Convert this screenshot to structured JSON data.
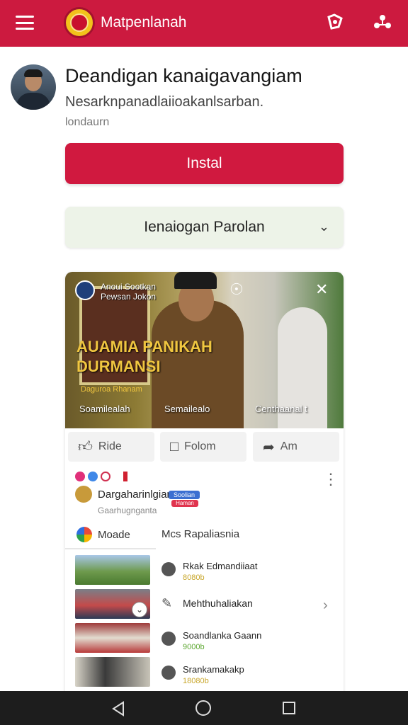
{
  "header": {
    "title": "Matpenlanah",
    "menu_icon": "hamburger-icon",
    "share_icon": "share-icon",
    "profile_icon": "network-icon",
    "accent_color": "#cc1a3f"
  },
  "profile": {
    "name": "Deandigan kanaigavangiam",
    "description": "Nesarknpanadlaiioakanlsarban.",
    "subtitle": "londaurn"
  },
  "install_button": {
    "label": "Instal",
    "color": "#d0193f"
  },
  "dropdown": {
    "label": "Ienaiogan Parolan"
  },
  "video": {
    "channel_name_line1": "Anoui Sootkan",
    "channel_name_line2": "Pewsan Jokon",
    "overlay_title_line1": "AUAMIA PANIKAH",
    "overlay_title_line2": "DURMANSI",
    "overlay_small": "Daguroa Rhanam",
    "caption_left": "Soamilealah",
    "caption_mid": "Semailealo",
    "caption_right": "Centhaanal t"
  },
  "actions": {
    "like": "Ride",
    "comment": "Folom",
    "share": "Am"
  },
  "post": {
    "author_name": "Dargaharinlgian",
    "badge_a": "Soolian",
    "badge_b": "Haman",
    "author_sub": "Gaarhugnganta"
  },
  "tabs": {
    "tab_a": "Moade",
    "tab_b": "Mcs Rapaliasnia"
  },
  "list": [
    {
      "title": "Rkak Edmandiiaat",
      "meta": "8080b"
    },
    {
      "title": "Mehthuhaliakan",
      "meta": ""
    },
    {
      "title": "Soandlanka Gaann",
      "meta": "9000b"
    },
    {
      "title": "Srankamakakp",
      "meta": "18080b"
    }
  ]
}
